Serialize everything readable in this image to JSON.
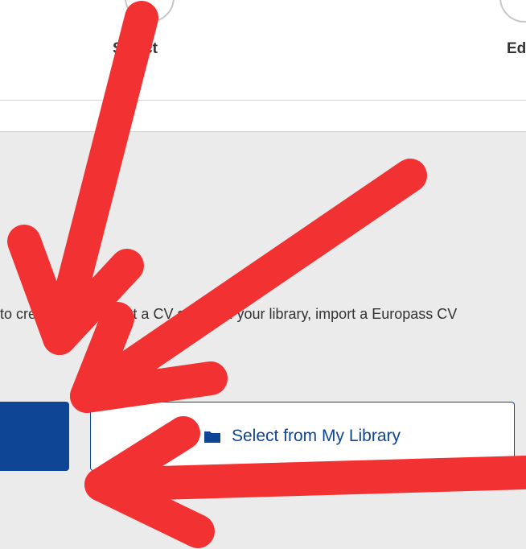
{
  "stepper": {
    "steps": [
      {
        "label": "Select"
      },
      {
        "label": "Edit"
      }
    ]
  },
  "main": {
    "instruction": "to create a CV, select a CV stored in your library, import a Europass CV",
    "primary_button_label": "",
    "secondary_button_label": "Select from My Library"
  },
  "colors": {
    "brand_blue": "#0e4595",
    "annotation_red": "#f23232"
  },
  "icons": {
    "secondary_button_icon": "folder-icon"
  }
}
